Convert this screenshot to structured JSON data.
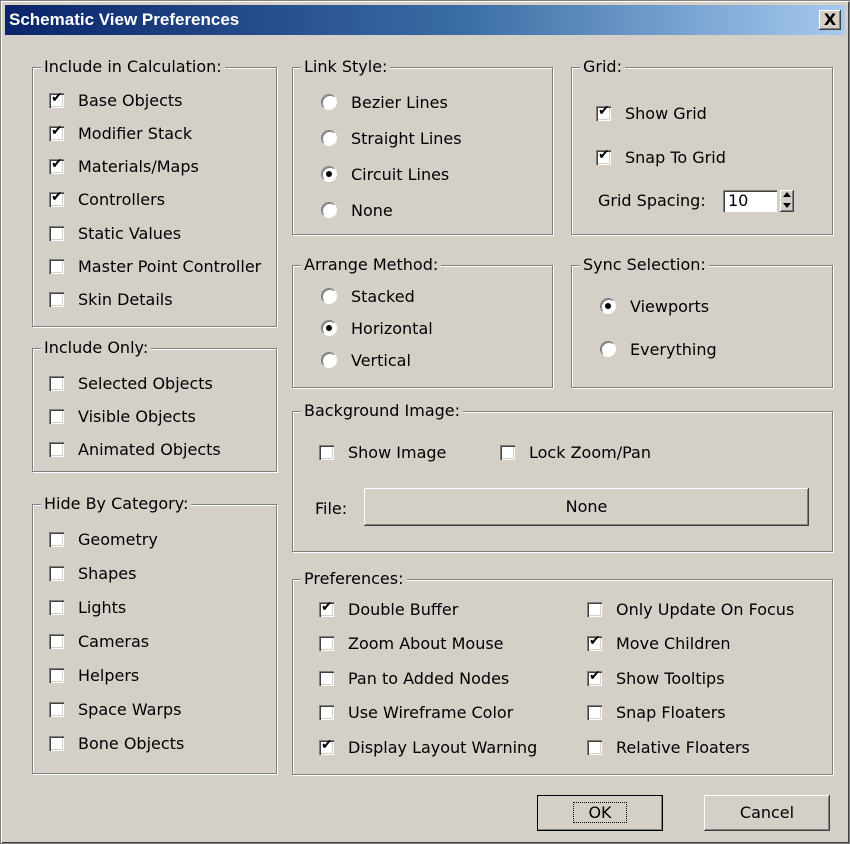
{
  "window": {
    "title": "Schematic View Preferences",
    "close_glyph": "X"
  },
  "include_calc": {
    "legend": "Include in Calculation:",
    "items": [
      {
        "label": "Base Objects",
        "checked": true
      },
      {
        "label": "Modifier Stack",
        "checked": true
      },
      {
        "label": "Materials/Maps",
        "checked": true
      },
      {
        "label": "Controllers",
        "checked": true
      },
      {
        "label": "Static Values",
        "checked": false
      },
      {
        "label": "Master Point Controller",
        "checked": false
      },
      {
        "label": "Skin Details",
        "checked": false
      }
    ]
  },
  "include_only": {
    "legend": "Include Only:",
    "items": [
      {
        "label": "Selected Objects",
        "checked": false
      },
      {
        "label": "Visible Objects",
        "checked": false
      },
      {
        "label": "Animated Objects",
        "checked": false
      }
    ]
  },
  "hide_by_category": {
    "legend": "Hide By Category:",
    "items": [
      {
        "label": "Geometry",
        "checked": false
      },
      {
        "label": "Shapes",
        "checked": false
      },
      {
        "label": "Lights",
        "checked": false
      },
      {
        "label": "Cameras",
        "checked": false
      },
      {
        "label": "Helpers",
        "checked": false
      },
      {
        "label": "Space Warps",
        "checked": false
      },
      {
        "label": "Bone Objects",
        "checked": false
      }
    ]
  },
  "link_style": {
    "legend": "Link Style:",
    "items": [
      {
        "label": "Bezier Lines",
        "selected": false
      },
      {
        "label": "Straight Lines",
        "selected": false
      },
      {
        "label": "Circuit Lines",
        "selected": true
      },
      {
        "label": "None",
        "selected": false
      }
    ]
  },
  "arrange_method": {
    "legend": "Arrange Method:",
    "items": [
      {
        "label": "Stacked",
        "selected": false
      },
      {
        "label": "Horizontal",
        "selected": true
      },
      {
        "label": "Vertical",
        "selected": false
      }
    ]
  },
  "grid": {
    "legend": "Grid:",
    "show_grid": {
      "label": "Show Grid",
      "checked": true
    },
    "snap_to_grid": {
      "label": "Snap To Grid",
      "checked": true
    },
    "spacing_label": "Grid Spacing:",
    "spacing_value": "10"
  },
  "sync_selection": {
    "legend": "Sync Selection:",
    "items": [
      {
        "label": "Viewports",
        "selected": true
      },
      {
        "label": "Everything",
        "selected": false
      }
    ]
  },
  "background_image": {
    "legend": "Background Image:",
    "show_image": {
      "label": "Show Image",
      "checked": false
    },
    "lock_zoom_pan": {
      "label": "Lock Zoom/Pan",
      "checked": false
    },
    "file_label": "File:",
    "file_button": "None"
  },
  "preferences": {
    "legend": "Preferences:",
    "left": [
      {
        "label": "Double Buffer",
        "checked": true
      },
      {
        "label": "Zoom About Mouse",
        "checked": false
      },
      {
        "label": "Pan to Added Nodes",
        "checked": false
      },
      {
        "label": "Use Wireframe Color",
        "checked": false
      },
      {
        "label": "Display Layout Warning",
        "checked": true
      }
    ],
    "right": [
      {
        "label": "Only Update On Focus",
        "checked": false
      },
      {
        "label": "Move Children",
        "checked": true
      },
      {
        "label": "Show Tooltips",
        "checked": true
      },
      {
        "label": "Snap Floaters",
        "checked": false
      },
      {
        "label": "Relative Floaters",
        "checked": false
      }
    ]
  },
  "buttons": {
    "ok": "OK",
    "cancel": "Cancel"
  }
}
